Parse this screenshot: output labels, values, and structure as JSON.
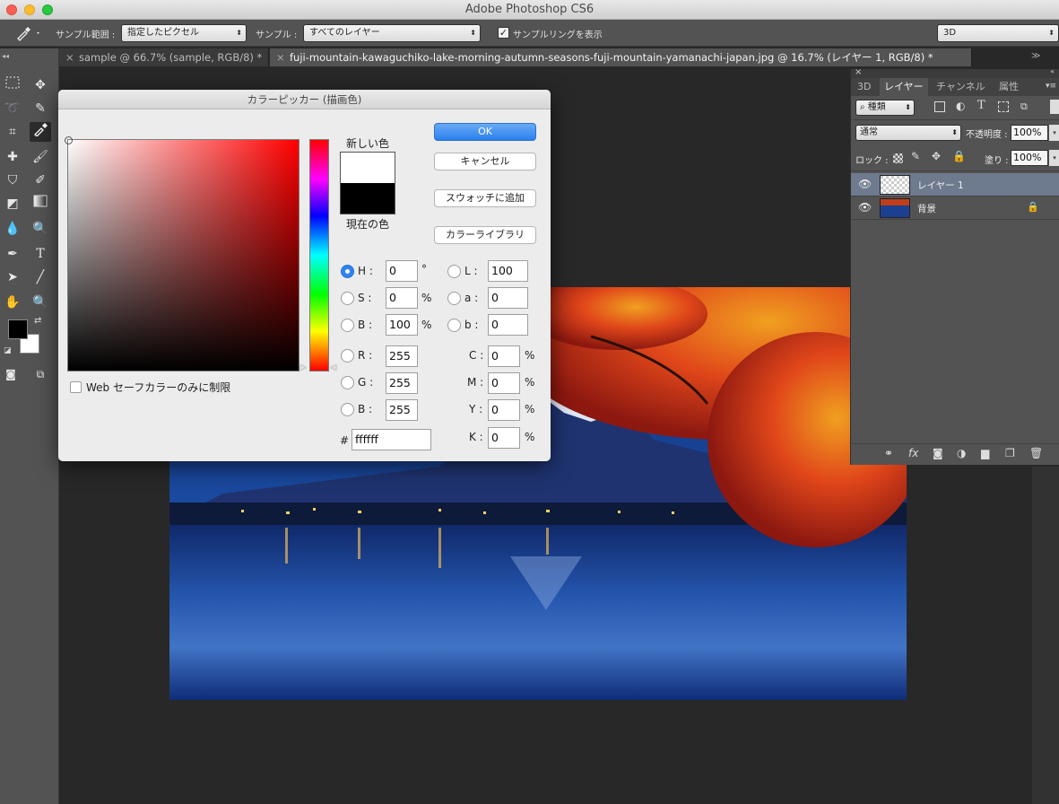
{
  "app": {
    "title": "Adobe Photoshop CS6"
  },
  "options_bar": {
    "sample_size_label": "サンプル範囲 :",
    "sample_size_value": "指定したピクセル",
    "sample_label": "サンプル :",
    "sample_value": "すべてのレイヤー",
    "show_sampling_ring_label": "サンプルリングを表示",
    "show_sampling_ring_checked": true,
    "workspace_value": "3D"
  },
  "document_tabs": [
    {
      "label": "sample @ 66.7% (sample, RGB/8) *",
      "active": false
    },
    {
      "label": "fuji-mountain-kawaguchiko-lake-morning-autumn-seasons-fuji-mountain-yamanachi-japan.jpg @ 16.7% (レイヤー 1, RGB/8) *",
      "active": true
    }
  ],
  "color_picker": {
    "title": "カラーピッカー (描画色)",
    "new_color_label": "新しい色",
    "current_color_label": "現在の色",
    "new_color": "#ffffff",
    "current_color": "#000000",
    "buttons": {
      "ok": "OK",
      "cancel": "キャンセル",
      "add_to_swatches": "スウォッチに追加",
      "color_libraries": "カラーライブラリ"
    },
    "hsb": {
      "h_label": "H :",
      "h": "0",
      "h_unit": "°",
      "s_label": "S :",
      "s": "0",
      "s_unit": "%",
      "b_label": "B :",
      "b": "100",
      "b_unit": "%",
      "selected": "H"
    },
    "lab": {
      "l_label": "L :",
      "l": "100",
      "a_label": "a :",
      "a": "0",
      "b_label": "b :",
      "b": "0"
    },
    "rgb": {
      "r_label": "R :",
      "r": "255",
      "g_label": "G :",
      "g": "255",
      "b_label": "B :",
      "b": "255"
    },
    "cmyk": {
      "c_label": "C :",
      "c": "0",
      "m_label": "M :",
      "m": "0",
      "y_label": "Y :",
      "y": "0",
      "k_label": "K :",
      "k": "0",
      "unit": "%"
    },
    "hex_label": "#",
    "hex": "ffffff",
    "web_colors_label": "Web セーフカラーのみに制限",
    "web_colors_checked": false,
    "hue_base": "#ff0000"
  },
  "layers_panel": {
    "tabs": [
      "3D",
      "レイヤー",
      "チャンネル",
      "属性"
    ],
    "active_tab": "レイヤー",
    "filter_label": "種類",
    "blend_mode": "通常",
    "opacity_label": "不透明度 :",
    "opacity": "100%",
    "lock_label": "ロック :",
    "fill_label": "塗り :",
    "fill": "100%",
    "layers": [
      {
        "name": "レイヤー 1",
        "selected": true,
        "locked": false
      },
      {
        "name": "背景",
        "selected": false,
        "locked": true
      }
    ]
  },
  "colors": {
    "foreground": "#000000",
    "background": "#ffffff",
    "accent": "#2d84ef"
  }
}
